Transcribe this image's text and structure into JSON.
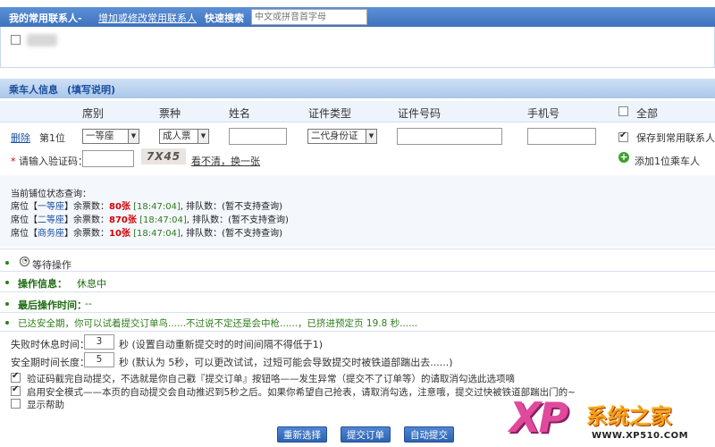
{
  "contacts_bar": {
    "title": "我的常用联系人-",
    "edit_link": "增加或修改常用联系人",
    "quick_search_label": "快速搜索",
    "quick_search_placeholder": "中文或拼音首字母"
  },
  "passenger_bar": {
    "title": "乘车人信息",
    "help_link": "(填写说明)"
  },
  "table_headers": {
    "seat_class": "席别",
    "ticket_type": "票种",
    "name": "姓名",
    "id_type": "证件类型",
    "id_number": "证件号码",
    "phone": "手机号",
    "select_all": "全部"
  },
  "passenger_row": {
    "delete_link": "删除",
    "position": "第1位",
    "seat_class_value": "一等座",
    "ticket_type_value": "成人票",
    "id_type_value": "二代身份证",
    "save_label": "保存到常用联系人",
    "save_checked": true
  },
  "captcha": {
    "label": "请输入验证码：",
    "image_text": "7X45",
    "refresh_link": "看不清，换一张",
    "add_passenger": "添加1位乘车人"
  },
  "status": {
    "heading": "当前铺位状态查询：",
    "rows": [
      {
        "prefix": "席位【",
        "seat": "一等座",
        "mid": "】余票数：",
        "count": "80张",
        "time": "[18:47:04]",
        "queue": ", 排队数：(暂不支持查询)"
      },
      {
        "prefix": "席位【",
        "seat": "二等座",
        "mid": "】余票数：",
        "count": "870张",
        "time": "[18:47:04]",
        "queue": ", 排队数：(暂不支持查询)"
      },
      {
        "prefix": "席位【",
        "seat": "商务座",
        "mid": "】余票数：",
        "count": "10张",
        "time": "[18:47:04]",
        "queue": ", 排队数：(暂不支持查询)"
      }
    ]
  },
  "operations": {
    "wait_label": "等待操作",
    "op_info_label": "操作信息：",
    "op_info_value": "休息中",
    "last_time_label": "最后操作时间：",
    "last_time_value": "--",
    "safe_period_text": "已达安全期，你可以试着提交订单鸟......不过说不定还是会中枪......，已挤进预定页 19.8 秒......"
  },
  "settings": {
    "fail_rest_label": "失败时休息时间：",
    "fail_rest_value": "3",
    "fail_rest_suffix": "秒 (设置自动重新提交时的时间间隔不得低于1)",
    "safe_time_label": "安全期时间长度：",
    "safe_time_value": "5",
    "safe_time_suffix": "秒 (默认为 5秒，可以更改试试，过短可能会导致提交时被铁道部踹出去......)",
    "option1": "验证码截完自动提交，不选就是你自己戳『提交订单』按钮咯——发生异常（提交不了订单等）的请取消勾选此选项嘀",
    "option2": "启用安全模式——本页的自动提交会自动推迟到5秒之后。如果你希望自己抢表，请取消勾选，注意哦，提交过快被铁道部踹出门的~",
    "option3": "显示帮助"
  },
  "buttons": {
    "reselect": "重新选择",
    "submit": "提交订单",
    "auto_submit": "自动提交"
  },
  "watermark": {
    "brand": "XP",
    "site_name": "系统之家",
    "url": "WWW.XP510.COM"
  }
}
